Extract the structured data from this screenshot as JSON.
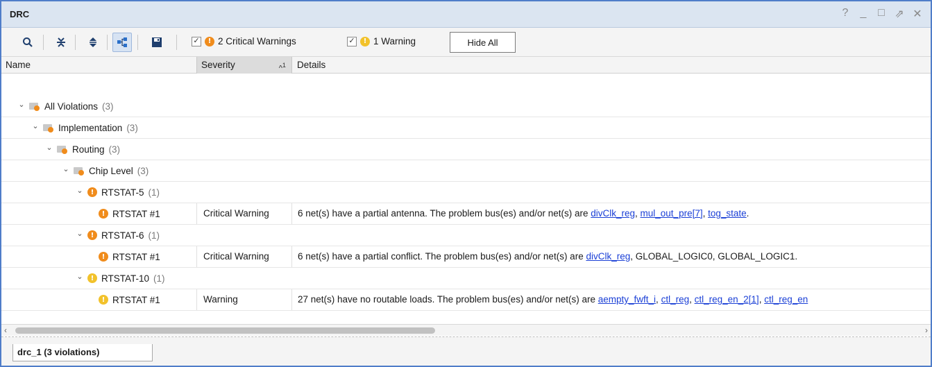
{
  "window": {
    "title": "DRC",
    "controls": [
      "?",
      "_",
      "□",
      "⇗",
      "✕"
    ]
  },
  "toolbar": {
    "icons": [
      "search-icon",
      "collapse-all-icon",
      "expand-all-icon",
      "show-hierarchy-icon",
      "save-icon"
    ],
    "filters": [
      {
        "checked": true,
        "severity": "critical",
        "label": "2 Critical Warnings"
      },
      {
        "checked": true,
        "severity": "warning",
        "label": "1 Warning"
      }
    ],
    "hide_all_label": "Hide All"
  },
  "columns": {
    "name": "Name",
    "severity": "Severity",
    "severity_sort": "^1",
    "details": "Details"
  },
  "rows": [
    {
      "label": "All Violations",
      "count": "(3)",
      "level": 0,
      "type": "folder"
    },
    {
      "label": "Implementation",
      "count": "(3)",
      "level": 1,
      "type": "folder"
    },
    {
      "label": "Routing",
      "count": "(3)",
      "level": 2,
      "type": "folder"
    },
    {
      "label": "Chip Level",
      "count": "(3)",
      "level": 3,
      "type": "folder"
    },
    {
      "label": "RTSTAT-5",
      "count": "(1)",
      "level": 4,
      "type": "critical"
    },
    {
      "label": "RTSTAT #1",
      "level": 5,
      "type": "critical",
      "severity": "Critical Warning",
      "details_text": "6 net(s) have a partial antenna. The problem bus(es) and/or net(s) are ",
      "links": [
        "divClk_reg",
        "mul_out_pre[7]",
        "tog_state"
      ],
      "trailing": "."
    },
    {
      "label": "RTSTAT-6",
      "count": "(1)",
      "level": 4,
      "type": "critical"
    },
    {
      "label": "RTSTAT #1",
      "level": 5,
      "type": "critical",
      "severity": "Critical Warning",
      "details_text": "6 net(s) have a partial conflict. The problem bus(es) and/or net(s) are ",
      "links": [
        "divClk_reg"
      ],
      "trailing": ", GLOBAL_LOGIC0, GLOBAL_LOGIC1."
    },
    {
      "label": "RTSTAT-10",
      "count": "(1)",
      "level": 4,
      "type": "warning"
    },
    {
      "label": "RTSTAT #1",
      "level": 5,
      "type": "warning",
      "severity": "Warning",
      "details_text": "27 net(s) have no routable loads. The problem bus(es) and/or net(s) are ",
      "links": [
        "aempty_fwft_i",
        "ctl_reg",
        "ctl_reg_en_2[1]",
        "ctl_reg_en"
      ],
      "trailing": ""
    }
  ],
  "result_tab": "drc_1 (3 violations)"
}
